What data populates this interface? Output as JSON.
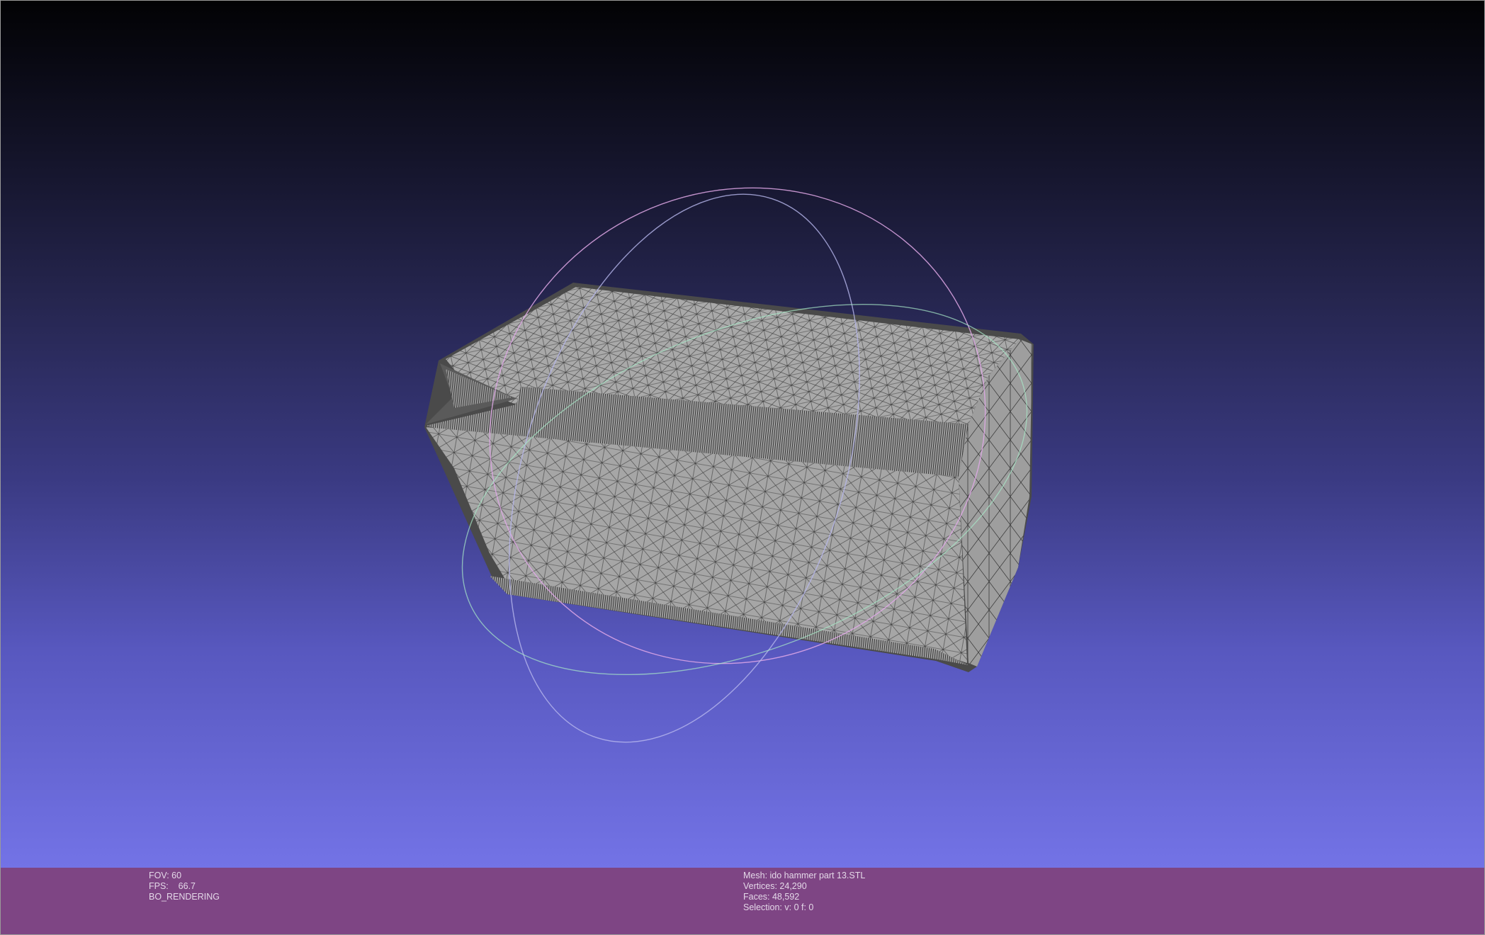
{
  "viewport": {
    "background_top": "#020204",
    "background_bottom": "#7373e6",
    "mesh_color": "#a7a7a7",
    "edge_color": "#4a4a4a",
    "trackball_colors": [
      "#e0a8e8",
      "#b8b8ee",
      "#a8e8c8"
    ]
  },
  "info_bar": {
    "background": "#7e4584",
    "left": {
      "fov": "FOV: 60",
      "fps": "FPS:    66.7",
      "mode": "BO_RENDERING"
    },
    "right": {
      "mesh": "Mesh: ido hammer part 13.STL",
      "vertices": "Vertices: 24,290",
      "faces": "Faces: 48,592",
      "selection": "Selection: v: 0 f: 0"
    }
  }
}
